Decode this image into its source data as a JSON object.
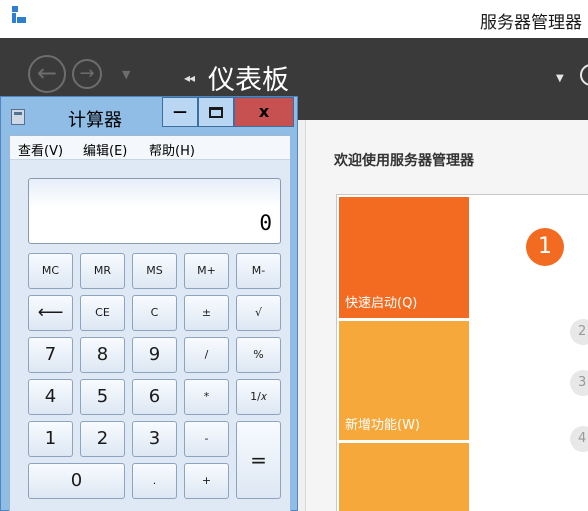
{
  "server_manager": {
    "title": "服务器管理器",
    "page_title": "仪表板",
    "breadcrumb_arrows": "◂◂",
    "welcome": "欢迎使用服务器管理器",
    "tiles": {
      "quick_start": "快速启动(Q)",
      "whats_new": "新增功能(W)"
    },
    "steps": [
      "1",
      "2",
      "3",
      "4"
    ],
    "colors": {
      "nav_bg": "#3a3a3a",
      "accent_orange": "#f26b21",
      "tile_light": "#f7a83b"
    }
  },
  "calculator": {
    "title": "计算器",
    "window_buttons": {
      "minimize": "—",
      "close": "x"
    },
    "menu": [
      "查看(V)",
      "编辑(E)",
      "帮助(H)"
    ],
    "display": "0",
    "keys": {
      "mc": "MC",
      "mr": "MR",
      "ms": "MS",
      "mplus": "M+",
      "mminus": "M-",
      "backspace": "⟵",
      "ce": "CE",
      "c": "C",
      "plusminus": "±",
      "sqrt": "√",
      "n7": "7",
      "n8": "8",
      "n9": "9",
      "divide": "/",
      "percent": "%",
      "n4": "4",
      "n5": "5",
      "n6": "6",
      "multiply": "*",
      "reciprocal": "1/𝑥",
      "n1": "1",
      "n2": "2",
      "n3": "3",
      "minus": "-",
      "equals": "=",
      "n0": "0",
      "decimal": ".",
      "plus": "+"
    }
  }
}
